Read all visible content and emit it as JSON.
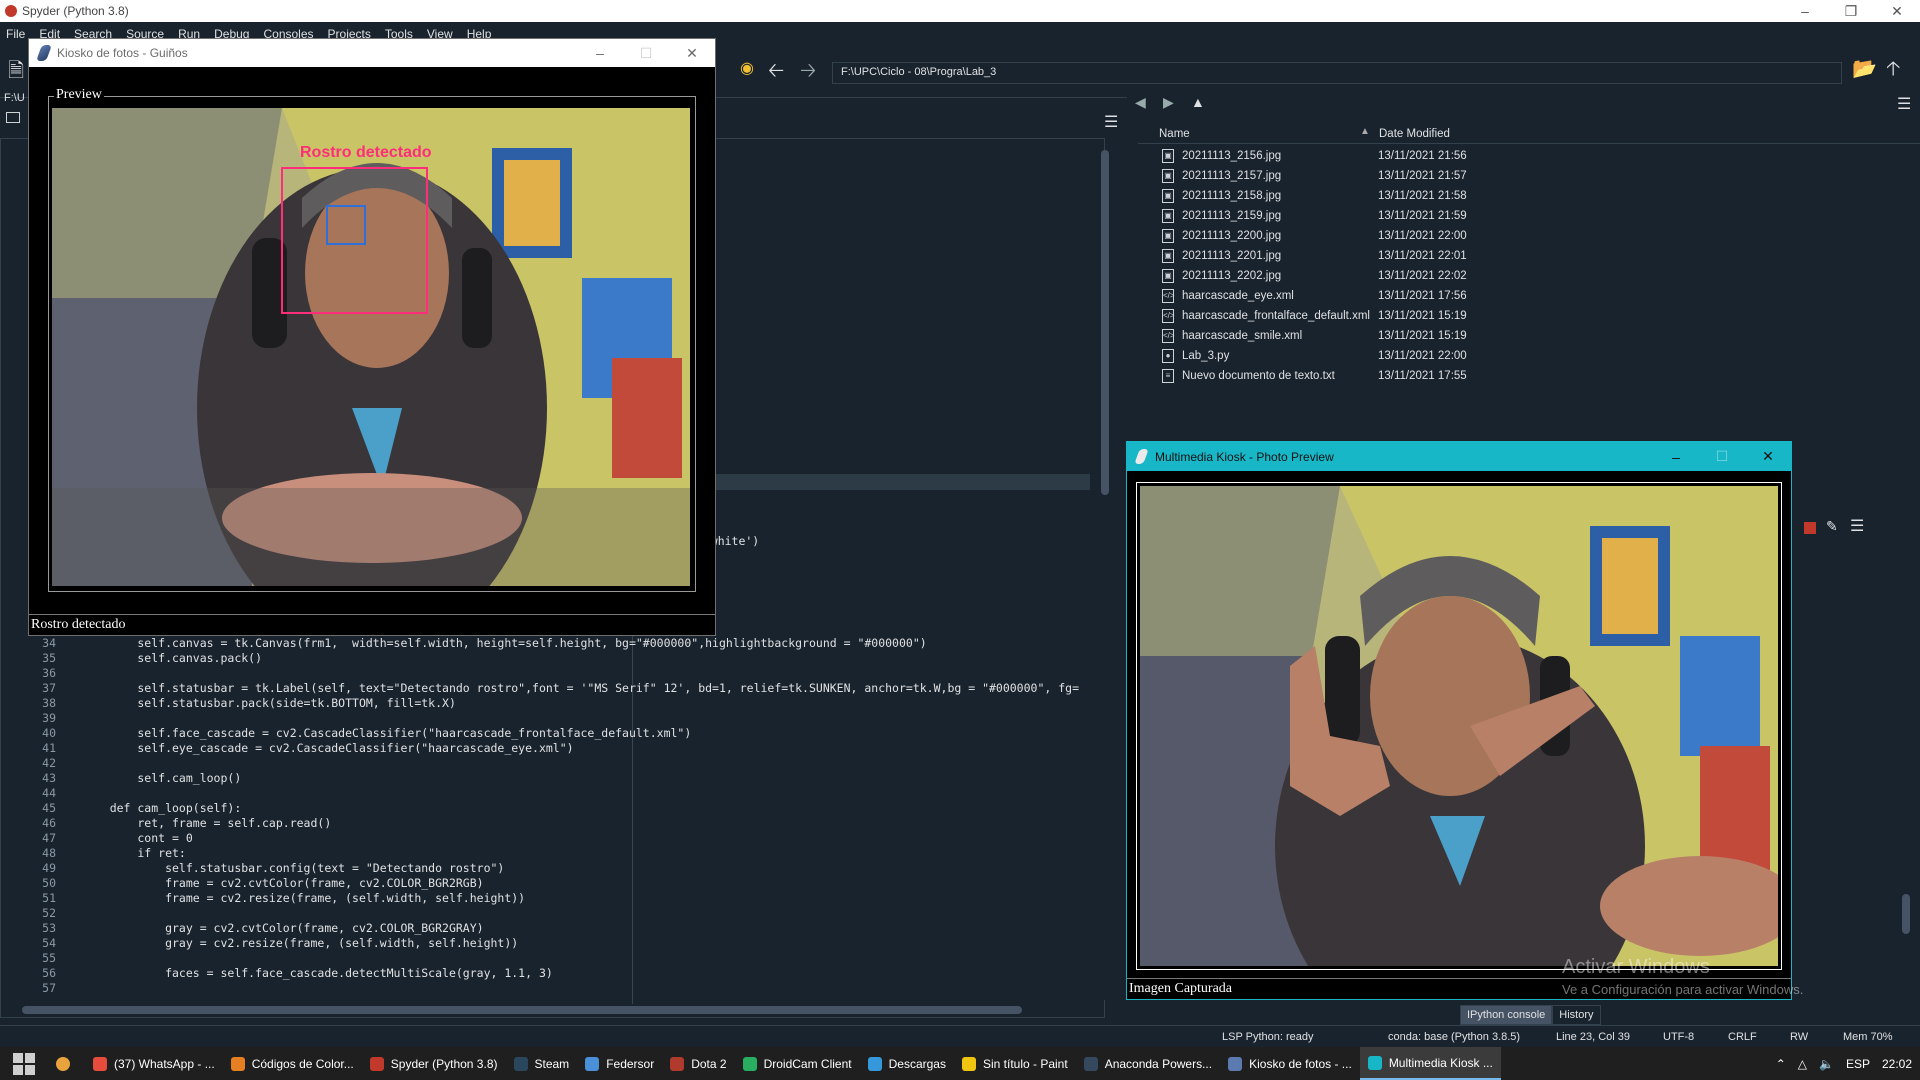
{
  "spyder": {
    "title": "Spyder (Python 3.8)",
    "menu": [
      "File",
      "Edit",
      "Search",
      "Source",
      "Run",
      "Debug",
      "Consoles",
      "Projects",
      "Tools",
      "View",
      "Help"
    ],
    "path": "F:\\UPC\\Ciclo - 08\\Progra\\Lab_3",
    "left_path_fragment": "F:\\U",
    "snippet_fragment": "g='white')"
  },
  "explorer": {
    "col_name": "Name",
    "col_date": "Date Modified",
    "files": [
      {
        "name": "20211113_2156.jpg",
        "date": "13/11/2021 21:56",
        "icon": "image-file-icon"
      },
      {
        "name": "20211113_2157.jpg",
        "date": "13/11/2021 21:57",
        "icon": "image-file-icon"
      },
      {
        "name": "20211113_2158.jpg",
        "date": "13/11/2021 21:58",
        "icon": "image-file-icon"
      },
      {
        "name": "20211113_2159.jpg",
        "date": "13/11/2021 21:59",
        "icon": "image-file-icon"
      },
      {
        "name": "20211113_2200.jpg",
        "date": "13/11/2021 22:00",
        "icon": "image-file-icon"
      },
      {
        "name": "20211113_2201.jpg",
        "date": "13/11/2021 22:01",
        "icon": "image-file-icon"
      },
      {
        "name": "20211113_2202.jpg",
        "date": "13/11/2021 22:02",
        "icon": "image-file-icon"
      },
      {
        "name": "haarcascade_eye.xml",
        "date": "13/11/2021 17:56",
        "icon": "xml-file-icon"
      },
      {
        "name": "haarcascade_frontalface_default.xml",
        "date": "13/11/2021 15:19",
        "icon": "xml-file-icon"
      },
      {
        "name": "haarcascade_smile.xml",
        "date": "13/11/2021 15:19",
        "icon": "xml-file-icon"
      },
      {
        "name": "Lab_3.py",
        "date": "13/11/2021 22:00",
        "icon": "python-file-icon"
      },
      {
        "name": "Nuevo documento de texto.txt",
        "date": "13/11/2021 17:55",
        "icon": "text-file-icon"
      }
    ]
  },
  "editor": {
    "line_numbers": [
      "34",
      "35",
      "36",
      "37",
      "38",
      "39",
      "40",
      "41",
      "42",
      "43",
      "44",
      "45",
      "46",
      "47",
      "48",
      "49",
      "50",
      "51",
      "52",
      "53",
      "54",
      "55",
      "56",
      "57"
    ],
    "lines": [
      "        self.canvas = tk.Canvas(frm1,  width=self.width, height=self.height, bg=\"#000000\",highlightbackground = \"#000000\")",
      "        self.canvas.pack()",
      "",
      "        self.statusbar = tk.Label(self, text=\"Detectando rostro\",font = '\"MS Serif\" 12', bd=1, relief=tk.SUNKEN, anchor=tk.W,bg = \"#000000\", fg=",
      "        self.statusbar.pack(side=tk.BOTTOM, fill=tk.X)",
      "",
      "        self.face_cascade = cv2.CascadeClassifier(\"haarcascade_frontalface_default.xml\")",
      "        self.eye_cascade = cv2.CascadeClassifier(\"haarcascade_eye.xml\")",
      "",
      "        self.cam_loop()",
      "",
      "    def cam_loop(self):",
      "        ret, frame = self.cap.read()",
      "        cont = 0",
      "        if ret:",
      "            self.statusbar.config(text = \"Detectando rostro\")",
      "            frame = cv2.cvtColor(frame, cv2.COLOR_BGR2RGB)",
      "            frame = cv2.resize(frame, (self.width, self.height))",
      "",
      "            gray = cv2.cvtColor(frame, cv2.COLOR_BGR2GRAY)",
      "            gray = cv2.resize(frame, (self.width, self.height))",
      "",
      "            faces = self.face_cascade.detectMultiScale(gray, 1.1, 3)",
      ""
    ]
  },
  "kiosk": {
    "title": "Kiosko de fotos - Guiños",
    "preview_label": "Preview",
    "detection_label": "Rostro detectado",
    "status": "Rostro detectado",
    "detect_color": "#ff2d7a",
    "eye_color": "#2e6fd8"
  },
  "multimedia": {
    "title": "Multimedia Kiosk - Photo Preview",
    "status": "Imagen Capturada",
    "accent": "#17b7c8"
  },
  "console": {
    "tabs": [
      "IPython console",
      "History"
    ]
  },
  "status_bar": {
    "lsp": "LSP Python: ready",
    "conda": "conda: base (Python 3.8.5)",
    "position": "Line 23, Col 39",
    "encoding": "UTF-8",
    "eol": "CRLF",
    "rw": "RW",
    "mem": "Mem 70%"
  },
  "watermark": {
    "line1": "Activar Windows",
    "line2": "Ve a Configuración para activar Windows."
  },
  "taskbar": {
    "items": [
      {
        "label": "(37) WhatsApp - ...",
        "color": "#e74c3c"
      },
      {
        "label": "Códigos de Color...",
        "color": "#e67e22"
      },
      {
        "label": "Spyder (Python 3.8)",
        "color": "#c0392b"
      },
      {
        "label": "Steam",
        "color": "#2a475e"
      },
      {
        "label": "Federsor",
        "color": "#4a90d9"
      },
      {
        "label": "Dota 2",
        "color": "#b03a2e"
      },
      {
        "label": "DroidCam Client",
        "color": "#27ae60"
      },
      {
        "label": "Descargas",
        "color": "#3498db"
      },
      {
        "label": "Sin título - Paint",
        "color": "#f1c40f"
      },
      {
        "label": "Anaconda Powers...",
        "color": "#34495e"
      },
      {
        "label": "Kiosko de fotos - ...",
        "color": "#5b7bb0"
      },
      {
        "label": "Multimedia Kiosk ...",
        "color": "#17b7c8"
      }
    ],
    "lang": "ESP",
    "time": "22:02"
  }
}
